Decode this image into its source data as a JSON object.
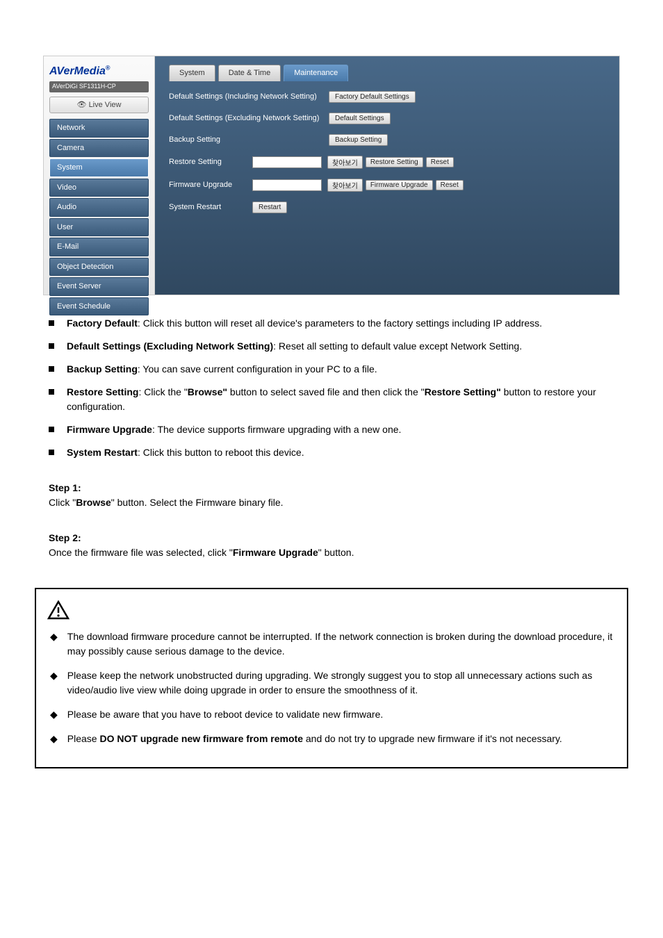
{
  "screenshot": {
    "logo_main": "AVerMedia",
    "logo_sub": "AVerDiGi SF1311H-CP",
    "live_view": "👁 Live View",
    "nav": [
      "Network",
      "Camera",
      "System",
      "Video",
      "Audio",
      "User",
      "E-Mail",
      "Object Detection",
      "Event Server",
      "Event Schedule"
    ],
    "nav_selected_index": 2,
    "tabs": [
      "System",
      "Date & Time",
      "Maintenance"
    ],
    "tab_active_index": 2,
    "rows": {
      "r0_label": "Default Settings (Including Network Setting)",
      "r0_btn": "Factory Default Settings",
      "r1_label": "Default Settings (Excluding Network Setting)",
      "r1_btn": "Default Settings",
      "r2_label": "Backup Setting",
      "r2_btn": "Backup Setting",
      "r3_label": "Restore Setting",
      "r3_browse": "찾아보기",
      "r3_btn": "Restore Setting",
      "r3_reset": "Reset",
      "r4_label": "Firmware Upgrade",
      "r4_browse": "찾아보기",
      "r4_btn": "Firmware Upgrade",
      "r4_reset": "Reset",
      "r5_label": "System Restart",
      "r5_btn": "Restart"
    }
  },
  "bullets": {
    "b0_a": "Factory Default",
    "b0_b": ": Click this button will reset all device's parameters to the factory settings including IP address.",
    "b1_a": "Default Settings (Excluding Network Setting)",
    "b1_b": ": Reset all setting to default value except Network Setting.",
    "b2_a": "Backup Setting",
    "b2_b": ": You can save current configuration in your PC to a file.",
    "b3_a": "Restore Setting",
    "b3_b": ": Click the \"",
    "b3_c": "Browse\"",
    "b3_d": " button to select saved file and then click the \"",
    "b3_e": "Restore Setting\"",
    "b3_f": " button to restore your configuration.",
    "b4_a": "Firmware Upgrade",
    "b4_b": ": The device supports firmware upgrading with a new one.",
    "b5_a": "System Restart",
    "b5_b": ": Click this button to reboot this device."
  },
  "steps": {
    "s0": "Step 1:",
    "s0_text_a": "Click \"",
    "s0_text_b": "Browse",
    "s0_text_c": "\" button. Select the Firmware binary file.",
    "s1": "Step 2:",
    "s1_text_a": "Once the firmware file was selected, click \"",
    "s1_text_b": "Firmware Upgrade",
    "s1_text_c": "\" button."
  },
  "caution": {
    "c0": "The download firmware procedure cannot be interrupted. If the network connection is broken during the download procedure, it may possibly cause serious damage to the device.",
    "c1": "Please keep the network unobstructed during upgrading. We strongly suggest you to stop all unnecessary actions such as video/audio live view while doing upgrade in order to ensure the smoothness of it.",
    "c2": "Please be aware that you have to reboot device to validate new firmware.",
    "c3_a": "Please ",
    "c3_b": "DO NOT upgrade new firmware from remote",
    "c3_c": " and do not try to upgrade new firmware if it's not necessary."
  }
}
